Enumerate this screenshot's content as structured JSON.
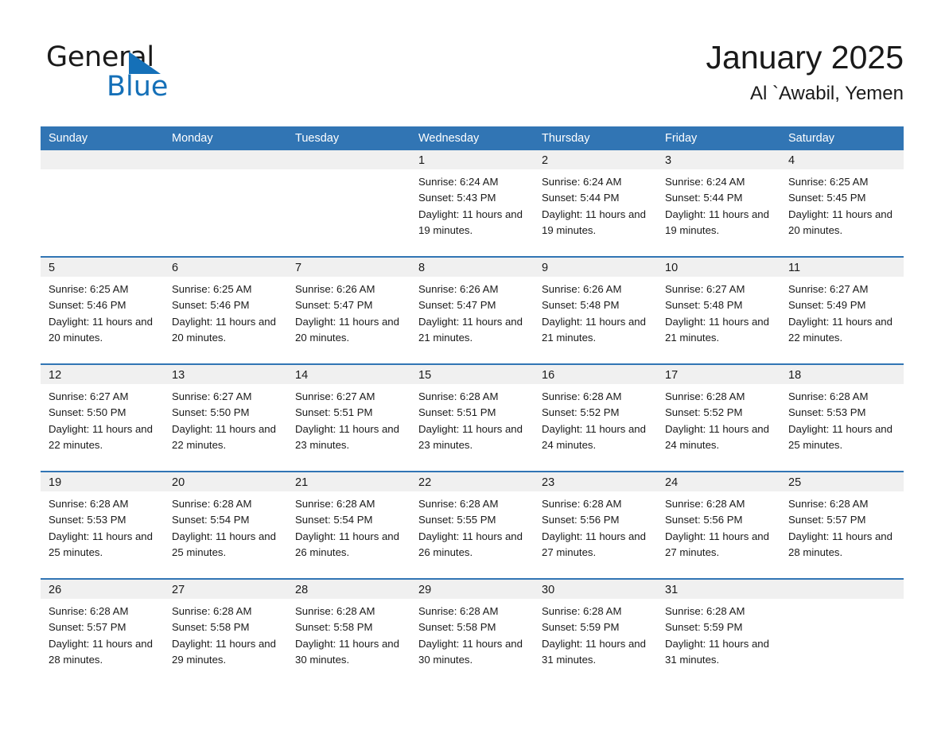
{
  "logo": {
    "word_one": "General",
    "word_two": "Blue",
    "triangle_color": "#1570b8"
  },
  "header": {
    "title": "January 2025",
    "subtitle": "Al `Awabil, Yemen",
    "accent_color": "#3175b4"
  },
  "calendar": {
    "weekday_headers": [
      "Sunday",
      "Monday",
      "Tuesday",
      "Wednesday",
      "Thursday",
      "Friday",
      "Saturday"
    ],
    "labels": {
      "sunrise_prefix": "Sunrise:",
      "sunset_prefix": "Sunset:",
      "daylight_prefix": "Daylight:"
    },
    "weeks": [
      [
        {
          "day": "",
          "sunrise": "",
          "sunset": "",
          "daylight": "",
          "empty": true
        },
        {
          "day": "",
          "sunrise": "",
          "sunset": "",
          "daylight": "",
          "empty": true
        },
        {
          "day": "",
          "sunrise": "",
          "sunset": "",
          "daylight": "",
          "empty": true
        },
        {
          "day": "1",
          "sunrise": "Sunrise: 6:24 AM",
          "sunset": "Sunset: 5:43 PM",
          "daylight": "Daylight: 11 hours and 19 minutes."
        },
        {
          "day": "2",
          "sunrise": "Sunrise: 6:24 AM",
          "sunset": "Sunset: 5:44 PM",
          "daylight": "Daylight: 11 hours and 19 minutes."
        },
        {
          "day": "3",
          "sunrise": "Sunrise: 6:24 AM",
          "sunset": "Sunset: 5:44 PM",
          "daylight": "Daylight: 11 hours and 19 minutes."
        },
        {
          "day": "4",
          "sunrise": "Sunrise: 6:25 AM",
          "sunset": "Sunset: 5:45 PM",
          "daylight": "Daylight: 11 hours and 20 minutes."
        }
      ],
      [
        {
          "day": "5",
          "sunrise": "Sunrise: 6:25 AM",
          "sunset": "Sunset: 5:46 PM",
          "daylight": "Daylight: 11 hours and 20 minutes."
        },
        {
          "day": "6",
          "sunrise": "Sunrise: 6:25 AM",
          "sunset": "Sunset: 5:46 PM",
          "daylight": "Daylight: 11 hours and 20 minutes."
        },
        {
          "day": "7",
          "sunrise": "Sunrise: 6:26 AM",
          "sunset": "Sunset: 5:47 PM",
          "daylight": "Daylight: 11 hours and 20 minutes."
        },
        {
          "day": "8",
          "sunrise": "Sunrise: 6:26 AM",
          "sunset": "Sunset: 5:47 PM",
          "daylight": "Daylight: 11 hours and 21 minutes."
        },
        {
          "day": "9",
          "sunrise": "Sunrise: 6:26 AM",
          "sunset": "Sunset: 5:48 PM",
          "daylight": "Daylight: 11 hours and 21 minutes."
        },
        {
          "day": "10",
          "sunrise": "Sunrise: 6:27 AM",
          "sunset": "Sunset: 5:48 PM",
          "daylight": "Daylight: 11 hours and 21 minutes."
        },
        {
          "day": "11",
          "sunrise": "Sunrise: 6:27 AM",
          "sunset": "Sunset: 5:49 PM",
          "daylight": "Daylight: 11 hours and 22 minutes."
        }
      ],
      [
        {
          "day": "12",
          "sunrise": "Sunrise: 6:27 AM",
          "sunset": "Sunset: 5:50 PM",
          "daylight": "Daylight: 11 hours and 22 minutes."
        },
        {
          "day": "13",
          "sunrise": "Sunrise: 6:27 AM",
          "sunset": "Sunset: 5:50 PM",
          "daylight": "Daylight: 11 hours and 22 minutes."
        },
        {
          "day": "14",
          "sunrise": "Sunrise: 6:27 AM",
          "sunset": "Sunset: 5:51 PM",
          "daylight": "Daylight: 11 hours and 23 minutes."
        },
        {
          "day": "15",
          "sunrise": "Sunrise: 6:28 AM",
          "sunset": "Sunset: 5:51 PM",
          "daylight": "Daylight: 11 hours and 23 minutes."
        },
        {
          "day": "16",
          "sunrise": "Sunrise: 6:28 AM",
          "sunset": "Sunset: 5:52 PM",
          "daylight": "Daylight: 11 hours and 24 minutes."
        },
        {
          "day": "17",
          "sunrise": "Sunrise: 6:28 AM",
          "sunset": "Sunset: 5:52 PM",
          "daylight": "Daylight: 11 hours and 24 minutes."
        },
        {
          "day": "18",
          "sunrise": "Sunrise: 6:28 AM",
          "sunset": "Sunset: 5:53 PM",
          "daylight": "Daylight: 11 hours and 25 minutes."
        }
      ],
      [
        {
          "day": "19",
          "sunrise": "Sunrise: 6:28 AM",
          "sunset": "Sunset: 5:53 PM",
          "daylight": "Daylight: 11 hours and 25 minutes."
        },
        {
          "day": "20",
          "sunrise": "Sunrise: 6:28 AM",
          "sunset": "Sunset: 5:54 PM",
          "daylight": "Daylight: 11 hours and 25 minutes."
        },
        {
          "day": "21",
          "sunrise": "Sunrise: 6:28 AM",
          "sunset": "Sunset: 5:54 PM",
          "daylight": "Daylight: 11 hours and 26 minutes."
        },
        {
          "day": "22",
          "sunrise": "Sunrise: 6:28 AM",
          "sunset": "Sunset: 5:55 PM",
          "daylight": "Daylight: 11 hours and 26 minutes."
        },
        {
          "day": "23",
          "sunrise": "Sunrise: 6:28 AM",
          "sunset": "Sunset: 5:56 PM",
          "daylight": "Daylight: 11 hours and 27 minutes."
        },
        {
          "day": "24",
          "sunrise": "Sunrise: 6:28 AM",
          "sunset": "Sunset: 5:56 PM",
          "daylight": "Daylight: 11 hours and 27 minutes."
        },
        {
          "day": "25",
          "sunrise": "Sunrise: 6:28 AM",
          "sunset": "Sunset: 5:57 PM",
          "daylight": "Daylight: 11 hours and 28 minutes."
        }
      ],
      [
        {
          "day": "26",
          "sunrise": "Sunrise: 6:28 AM",
          "sunset": "Sunset: 5:57 PM",
          "daylight": "Daylight: 11 hours and 28 minutes."
        },
        {
          "day": "27",
          "sunrise": "Sunrise: 6:28 AM",
          "sunset": "Sunset: 5:58 PM",
          "daylight": "Daylight: 11 hours and 29 minutes."
        },
        {
          "day": "28",
          "sunrise": "Sunrise: 6:28 AM",
          "sunset": "Sunset: 5:58 PM",
          "daylight": "Daylight: 11 hours and 30 minutes."
        },
        {
          "day": "29",
          "sunrise": "Sunrise: 6:28 AM",
          "sunset": "Sunset: 5:58 PM",
          "daylight": "Daylight: 11 hours and 30 minutes."
        },
        {
          "day": "30",
          "sunrise": "Sunrise: 6:28 AM",
          "sunset": "Sunset: 5:59 PM",
          "daylight": "Daylight: 11 hours and 31 minutes."
        },
        {
          "day": "31",
          "sunrise": "Sunrise: 6:28 AM",
          "sunset": "Sunset: 5:59 PM",
          "daylight": "Daylight: 11 hours and 31 minutes."
        },
        {
          "day": "",
          "sunrise": "",
          "sunset": "",
          "daylight": "",
          "empty": true
        }
      ]
    ]
  }
}
